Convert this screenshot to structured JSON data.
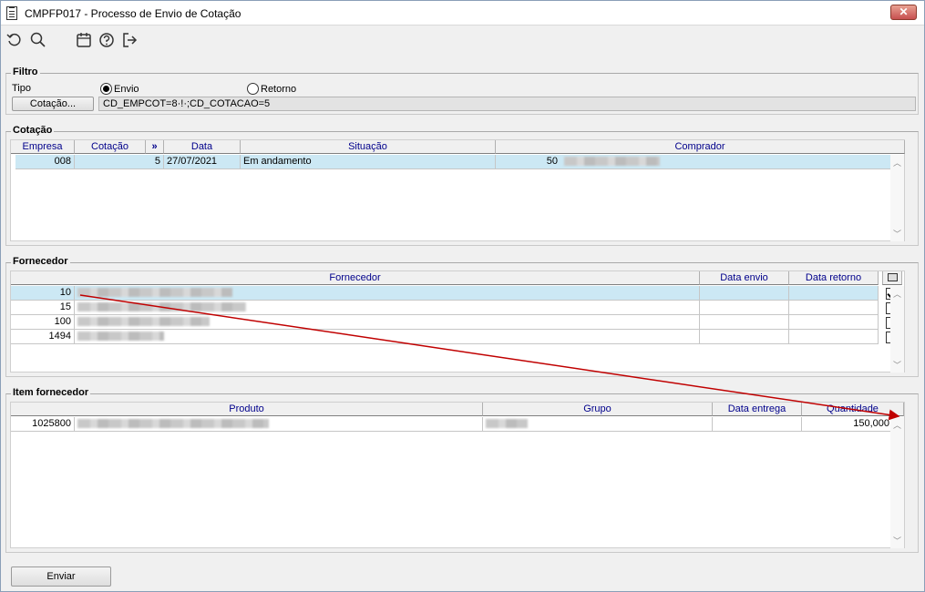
{
  "window": {
    "title": "CMPFP017 - Processo de Envio de Cotação",
    "close_label": "✕"
  },
  "filtro": {
    "group_title": "Filtro",
    "tipo_label": "Tipo",
    "radio_envio": "Envio",
    "radio_retorno": "Retorno",
    "selected": "Envio",
    "cotacao_button": "Cotação...",
    "cotacao_value": "CD_EMPCOT=8·!·;CD_COTACAO=5"
  },
  "cotacao": {
    "group_title": "Cotação",
    "columns": [
      "Empresa",
      "Cotação",
      "»",
      "Data",
      "Situação",
      "Comprador"
    ],
    "rows": [
      {
        "empresa": "008",
        "cotacao": "5",
        "data": "27/07/2021",
        "situacao": "Em andamento",
        "comprador": "50"
      }
    ]
  },
  "fornecedor": {
    "group_title": "Fornecedor",
    "columns": [
      "Fornecedor",
      "Data envio",
      "Data retorno"
    ],
    "rows": [
      {
        "codigo": "10",
        "checked": true
      },
      {
        "codigo": "15",
        "checked": false
      },
      {
        "codigo": "100",
        "checked": false
      },
      {
        "codigo": "1494",
        "checked": false
      }
    ]
  },
  "item": {
    "group_title": "Item fornecedor",
    "columns": [
      "Produto",
      "Grupo",
      "Data entrega",
      "Quantidade"
    ],
    "rows": [
      {
        "produto": "1025800",
        "quantidade": "150,000"
      }
    ]
  },
  "footer": {
    "enviar_button": "Enviar"
  },
  "colors": {
    "header_text": "#00008b",
    "selection": "#cce8f4",
    "annotation_arrow": "#c00000"
  },
  "icons": [
    "refresh-icon",
    "search-icon",
    "calendar-icon",
    "help-icon",
    "exit-icon"
  ]
}
